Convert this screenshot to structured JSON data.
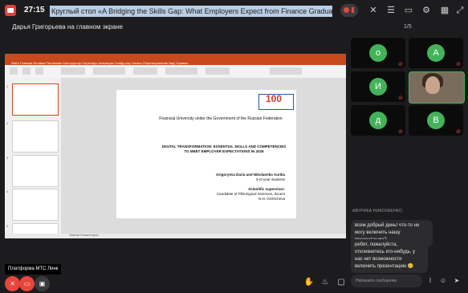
{
  "header": {
    "timer": "27:15",
    "meeting_title": "Круглый стол «A Bridging the Skills Gap: What Employers Expect from Finance Graduates Tod"
  },
  "presenter_label": "Дарья Григорьева на главном экране",
  "pager": "1/5",
  "presentation": {
    "ribbon_tabs": "Файл   Главная   Вставка   Рисование   Конструктор   Переходы   Анимация   Слайд-шоу   Запись   Рецензирование   Вид   Справка",
    "slide_numbers": [
      "1",
      "2",
      "3",
      "4",
      "5"
    ],
    "logo_text": "100",
    "university": "Financial University under the Government of the Russian Federation",
    "title_line1": "DIGITAL TRANSFORMATION: ESSENTIAL SKILLS AND COMPETENCIES",
    "title_line2": "TO MEET EMPLOYER EXPECTATIONS IN 2025",
    "authors": "Grigoryeva Daria and Nikolaenko Aurika",
    "year": "3-rd year students",
    "supervisor_label": "Scientific supervisor:",
    "supervisor_title": "Candidate of Philological Sciences, docent",
    "supervisor_name": "N.N. Grishcheva",
    "status_bar": "Заметки   Комментарии"
  },
  "platform_label": "Платформа МТС Линк",
  "participants": [
    {
      "initial": "о",
      "muted": true
    },
    {
      "initial": "А",
      "muted": true
    },
    {
      "initial": "И",
      "muted": true
    },
    {
      "initial": "",
      "video": true,
      "muted": false
    },
    {
      "initial": "д",
      "muted": true
    },
    {
      "initial": "В",
      "muted": true
    }
  ],
  "chat": {
    "sender": "АВУРИКА НИКОЛАЕНКО",
    "messages": [
      "всем добрый день! что-то не могу включить нашу презентацию?",
      "ребят, пожалуйста, откликнитесь кто-нибудь, у нас нет возможности включить презентацию 🥲"
    ],
    "input_placeholder": "Напишите сообщение"
  },
  "icons": {
    "app": "app-logo-icon",
    "record": "record-icon",
    "mic_off": "mic-off-icon",
    "camera_off": "camera-off-icon",
    "screen_share": "screen-share-icon",
    "raise_hand": "raise-hand-icon",
    "reaction": "fire-reaction-icon",
    "layout": "layout-icon",
    "more": "more-icon",
    "attach": "attach-icon",
    "emoji": "emoji-icon",
    "send": "send-icon"
  },
  "colors": {
    "accent_green": "#43b35a",
    "danger_red": "#e8453c",
    "background": "#1c1c1e",
    "ppt_orange": "#c74a1d"
  }
}
